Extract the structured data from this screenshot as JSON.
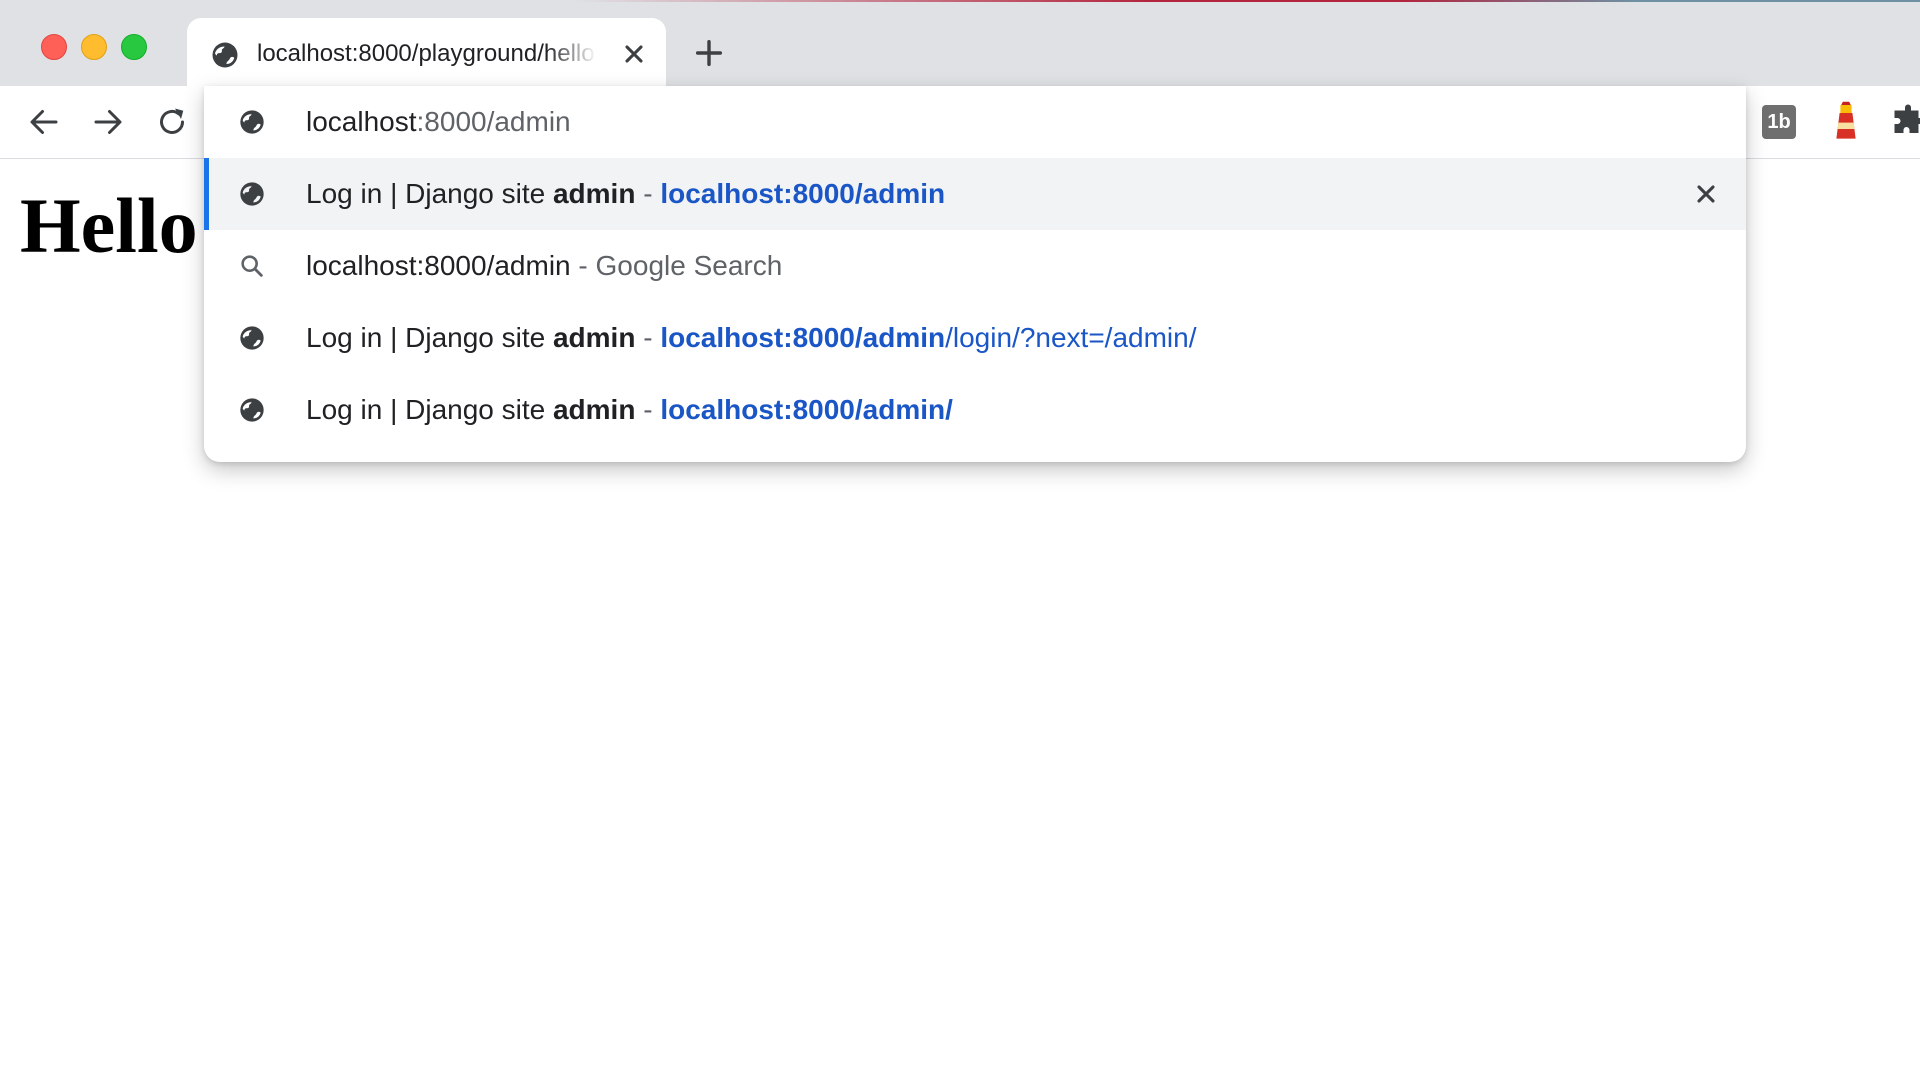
{
  "browser": {
    "tab": {
      "title": "localhost:8000/playground/hello",
      "close_icon": "close-icon",
      "favicon": "globe-icon"
    },
    "new_tab_icon": "plus-icon",
    "toolbar": {
      "back_icon": "arrow-left-icon",
      "forward_icon": "arrow-right-icon",
      "reload_icon": "reload-icon",
      "extensions": [
        {
          "name": "1b-extension-icon",
          "label": "1b"
        },
        {
          "name": "lighthouse-extension-icon"
        },
        {
          "name": "puzzle-extensions-icon"
        }
      ]
    },
    "colors": {
      "link_blue": "#1a56c6",
      "selection_bar": "#1a73e8",
      "traffic_red": "#fe5f57",
      "traffic_yellow": "#febc2e",
      "traffic_green": "#28c840"
    }
  },
  "omnibox": {
    "input": {
      "typed": "localhost",
      "completion": ":8000/admin"
    },
    "suggestions": [
      {
        "icon": "globe-icon",
        "title_prefix": "Log in | Django site ",
        "title_bold": "admin",
        "separator": " - ",
        "url_bold": "localhost:8000/admin",
        "url_rest": "",
        "selected": true,
        "remove_icon": "close-icon"
      },
      {
        "icon": "search-icon",
        "query": "localhost:8000/admin",
        "separator": " - ",
        "suffix": "Google Search"
      },
      {
        "icon": "globe-icon",
        "title_prefix": "Log in | Django site ",
        "title_bold": "admin",
        "separator": " - ",
        "url_bold": "localhost:8000/admin",
        "url_rest": "/login/?next=/admin/"
      },
      {
        "icon": "globe-icon",
        "title_prefix": "Log in | Django site ",
        "title_bold": "admin",
        "separator": " - ",
        "url_bold": "localhost:8000/admin/",
        "url_rest": ""
      }
    ]
  },
  "page": {
    "heading": "Hello World"
  }
}
